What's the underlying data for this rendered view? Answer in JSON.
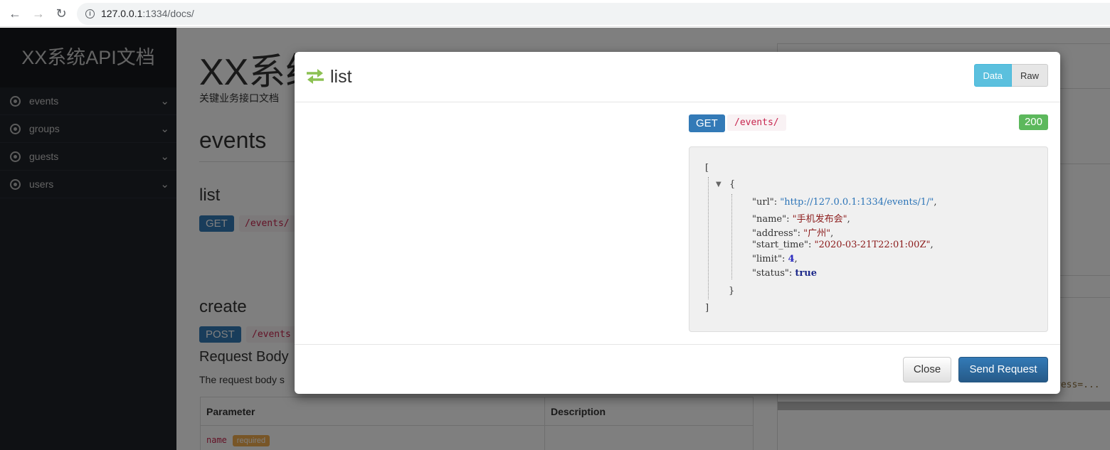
{
  "browser": {
    "url_host": "127.0.0.1",
    "url_rest": ":1334/docs/"
  },
  "sidebar": {
    "title": "XX系统API文档",
    "items": [
      {
        "label": "events"
      },
      {
        "label": "groups"
      },
      {
        "label": "guests"
      },
      {
        "label": "users"
      }
    ]
  },
  "page": {
    "title": "XX系统API文档",
    "subtitle": "关键业务接口文档",
    "section": "events",
    "list_heading": "list",
    "list_method": "GET",
    "list_path": "/events/",
    "create_heading": "create",
    "create_method": "POST",
    "create_path": "/events",
    "request_body_heading": "Request Body",
    "request_body_text": "The request body s",
    "table": {
      "headers": [
        "Parameter",
        "Description"
      ],
      "rows": [
        {
          "name": "name",
          "badge": "required"
        }
      ]
    },
    "right_code": "ress=..."
  },
  "modal": {
    "title": "list",
    "toggle": {
      "data": "Data",
      "raw": "Raw"
    },
    "method": "GET",
    "path": "/events/",
    "status": "200",
    "json": {
      "open_bracket": "[",
      "open_brace": "{",
      "close_brace": "}",
      "close_bracket": "]",
      "fields": [
        {
          "key": "\"url\"",
          "sep": ": ",
          "value": "\"http://127.0.0.1:1334/events/1/\"",
          "tail": ","
        },
        {
          "key": "\"name\"",
          "sep": ": ",
          "value": "\"手机发布会\"",
          "tail": ","
        },
        {
          "key": "\"address\"",
          "sep": ": ",
          "value": "\"广州\"",
          "tail": ","
        },
        {
          "key": "\"start_time\"",
          "sep": ": ",
          "value": "\"2020-03-21T22:01:00Z\"",
          "tail": ","
        },
        {
          "key": "\"limit\"",
          "sep": ": ",
          "value": "4",
          "tail": ","
        },
        {
          "key": "\"status\"",
          "sep": ": ",
          "value": "true",
          "tail": ""
        }
      ]
    },
    "close_label": "Close",
    "send_label": "Send Request"
  },
  "colors": {
    "accent": "#337ab7",
    "status_ok": "#5cb85c",
    "toggle_active": "#5bc0de",
    "sidebar_bg": "#1e2228"
  }
}
